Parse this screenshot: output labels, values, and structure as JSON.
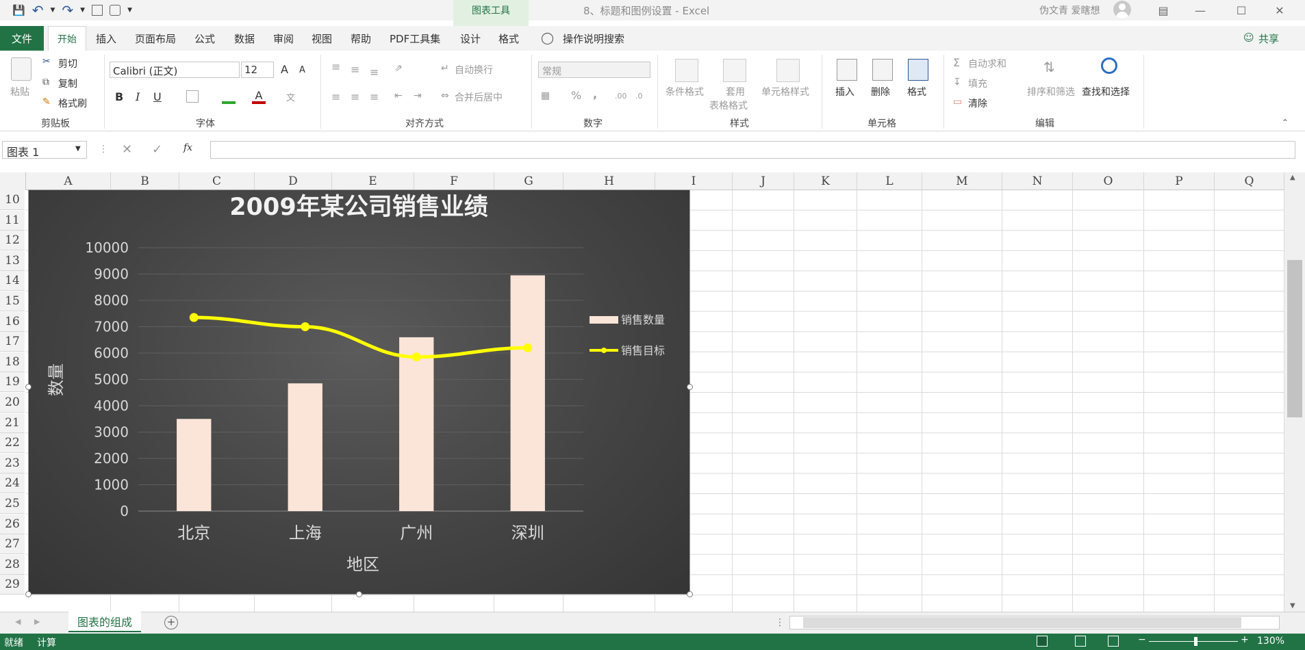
{
  "title_bar": {
    "contextual_title": "图表工具",
    "document_title": "8、标题和图例设置 - Excel",
    "user_name": "伪文青 爱瞎想",
    "qat_icons": [
      "save-icon",
      "undo-icon",
      "redo-icon",
      "form-icon",
      "print-preview-icon",
      "customize-qat-icon"
    ],
    "window_icons": [
      "ribbon-display-icon",
      "minimize-icon",
      "restore-icon",
      "close-icon"
    ]
  },
  "tabs": [
    "文件",
    "开始",
    "插入",
    "页面布局",
    "公式",
    "数据",
    "审阅",
    "视图",
    "帮助",
    "PDF工具集",
    "设计",
    "格式"
  ],
  "tell_me": "操作说明搜索",
  "share": "共享",
  "ribbon": {
    "clipboard": {
      "paste": "粘贴",
      "cut": "剪切",
      "copy": "复制",
      "format_painter": "格式刷",
      "group": "剪贴板"
    },
    "font": {
      "name": "Calibri (正文)",
      "size": "12",
      "bold": "B",
      "italic": "I",
      "underline": "U",
      "grow": "A",
      "shrink": "A",
      "group": "字体"
    },
    "alignment": {
      "wrap": "自动换行",
      "merge": "合并后居中",
      "group": "对齐方式"
    },
    "number": {
      "format": "常规",
      "percent": "%",
      "comma": ",",
      "group": "数字"
    },
    "styles": {
      "conditional": "条件格式",
      "table_l1": "套用",
      "table_l2": "表格格式",
      "cell_styles": "单元格样式",
      "group": "样式"
    },
    "cells": {
      "insert": "插入",
      "delete": "删除",
      "format": "格式",
      "group": "单元格"
    },
    "editing": {
      "autosum": "自动求和",
      "fill": "填充",
      "clear": "清除",
      "sort": "排序和筛选",
      "find": "查找和选择",
      "group": "编辑"
    }
  },
  "formula_bar": {
    "name_box": "图表 1",
    "fx": "fx",
    "value": ""
  },
  "columns": [
    "A",
    "B",
    "C",
    "D",
    "E",
    "F",
    "G",
    "H",
    "I",
    "J",
    "K",
    "L",
    "M",
    "N",
    "O",
    "P",
    "Q"
  ],
  "rows": [
    "10",
    "11",
    "12",
    "13",
    "14",
    "15",
    "16",
    "17",
    "18",
    "19",
    "20",
    "21",
    "22",
    "23",
    "24",
    "25",
    "26",
    "27",
    "28",
    "29"
  ],
  "chart_data": {
    "type": "bar",
    "title": "2009年某公司销售业绩",
    "xlabel": "地区",
    "ylabel": "数量",
    "categories": [
      "北京",
      "上海",
      "广州",
      "深圳"
    ],
    "ylim": [
      0,
      10000
    ],
    "yticks": [
      "0",
      "1000",
      "2000",
      "3000",
      "4000",
      "5000",
      "6000",
      "7000",
      "8000",
      "9000",
      "10000"
    ],
    "grid": true,
    "legend_position": "right",
    "series": [
      {
        "name": "销售数量",
        "kind": "bar",
        "color": "#fbe4d8",
        "values": [
          3500,
          4850,
          6600,
          8950
        ]
      },
      {
        "name": "销售目标",
        "kind": "line",
        "color": "#ffff00",
        "values": [
          7350,
          7000,
          5850,
          6200
        ]
      }
    ]
  },
  "sheet_tabs": [
    "图表的组成"
  ],
  "status": {
    "ready": "就绪",
    "calc": "计算",
    "zoom": "130%",
    "plus": "+",
    "minus": "−"
  }
}
